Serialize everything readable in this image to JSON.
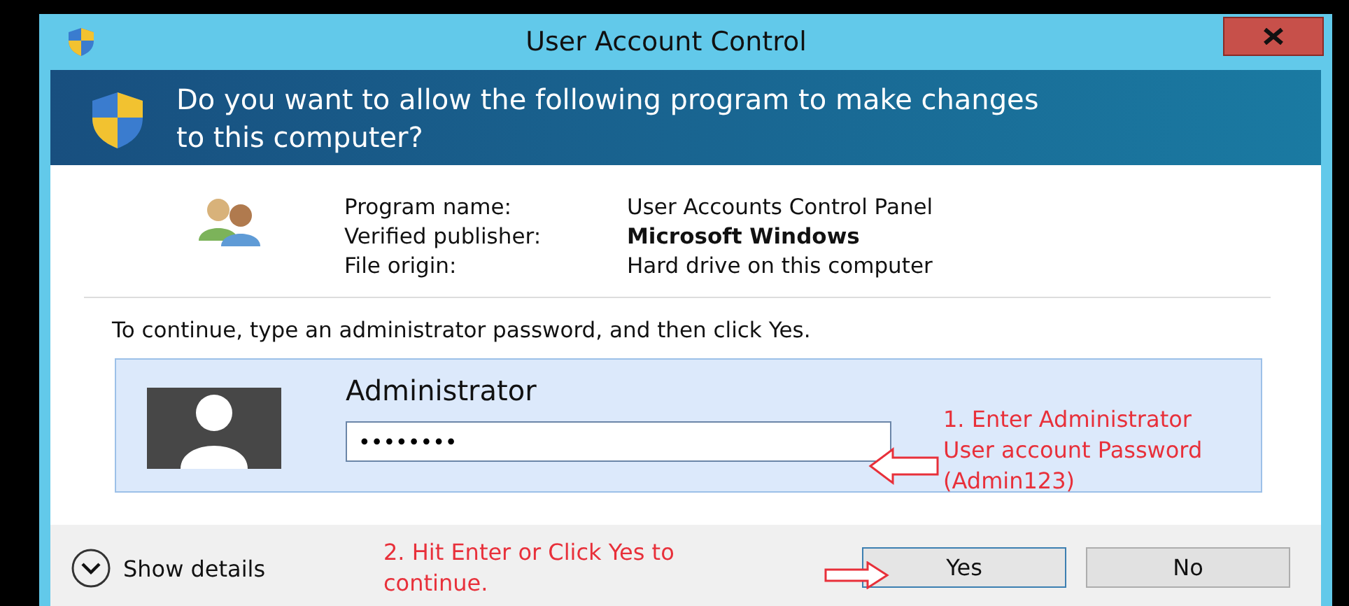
{
  "window": {
    "title": "User Account Control"
  },
  "header": {
    "question": "Do you want to allow the following program to make changes to this computer?"
  },
  "program_info": [
    {
      "label": "Program name:",
      "value": "User Accounts Control Panel",
      "bold": false
    },
    {
      "label": "Verified publisher:",
      "value": "Microsoft Windows",
      "bold": true
    },
    {
      "label": "File origin:",
      "value": "Hard drive on this computer",
      "bold": false
    }
  ],
  "instruction": "To continue, type an administrator password, and then click Yes.",
  "credential": {
    "user": "Administrator",
    "password": "••••••••"
  },
  "footer": {
    "show_details": "Show details",
    "buttons": [
      {
        "label": "Yes",
        "selected": true
      },
      {
        "label": "No",
        "selected": false
      }
    ]
  },
  "annotations": [
    {
      "text": "1. Enter Administrator\nUser account Password\n(Admin123)"
    },
    {
      "text": "2. Hit Enter or Click Yes to\ncontinue."
    }
  ]
}
